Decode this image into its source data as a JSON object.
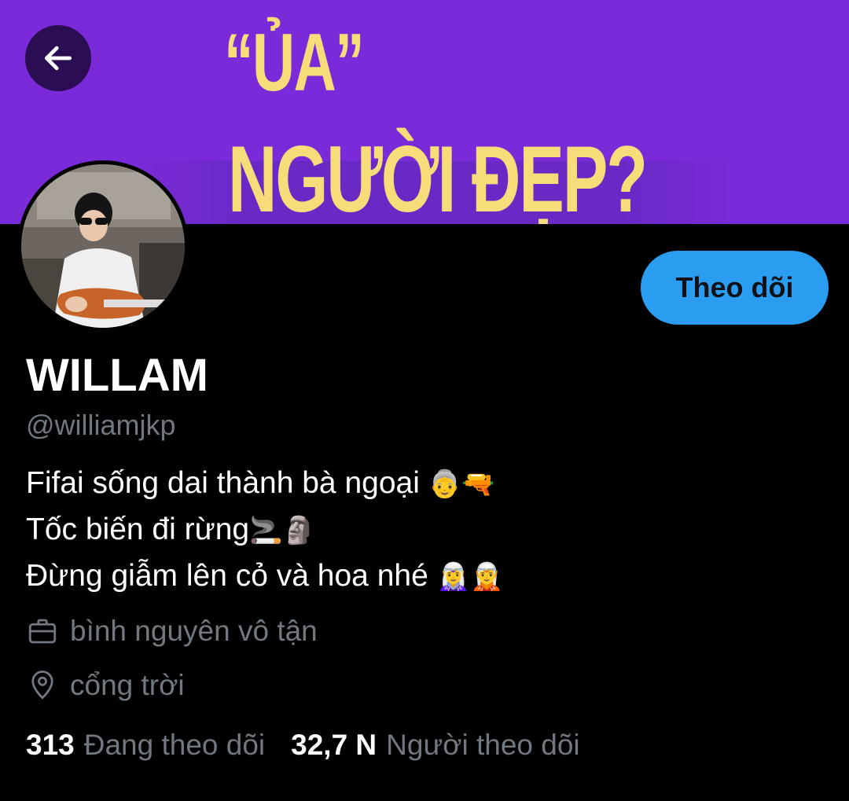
{
  "banner": {
    "line1": "“ỦA”",
    "line2": "NGƯỜI ĐẸP?"
  },
  "header": {
    "back_icon": "arrow-left-icon"
  },
  "profile": {
    "follow_label": "Theo dõi",
    "display_name": "WILLAM",
    "handle": "@williamjkp",
    "bio": {
      "line1_text": "Fifai sống dai thành bà ngoại ",
      "line1_emoji": "👵🔫",
      "line2_text": "Tốc biến đi rừng",
      "line2_emoji": "🚬🗿",
      "line3_text": "Đừng giẫm lên cỏ và hoa nhé ",
      "line3_emoji": "🧝‍♀️🧝"
    },
    "work": "bình nguyên vô tận",
    "location": "cổng trời"
  },
  "stats": {
    "following_count": "313",
    "following_label": "Đang theo dõi",
    "followers_count": "32,7 N",
    "followers_label": "Người theo dõi"
  },
  "colors": {
    "banner_bg": "#7a2ad8",
    "banner_text": "#f6dd7a",
    "accent": "#2a9df0",
    "muted": "#71787f",
    "background": "#000000"
  }
}
